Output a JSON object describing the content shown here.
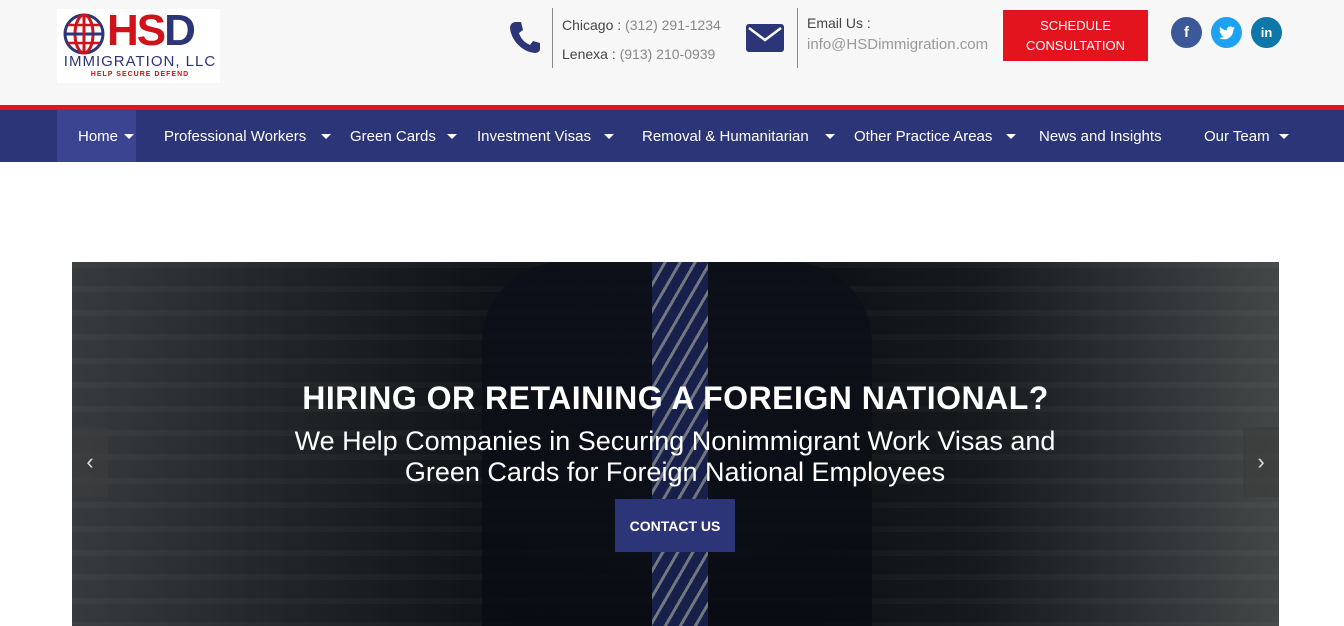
{
  "header": {
    "logo": {
      "mark": "HSD",
      "name": "IMMIGRATION, LLC",
      "tagline": "HELP SECURE DEFEND"
    },
    "phones": [
      {
        "label": "Chicago : ",
        "number": "(312) 291-1234"
      },
      {
        "label": "Lenexa : ",
        "number": "(913) 210-0939"
      }
    ],
    "email": {
      "label": "Email Us :",
      "value": "info@HSDimmigration.com"
    },
    "cta": {
      "line1": "SCHEDULE",
      "line2": "CONSULTATION"
    },
    "social": [
      {
        "icon": "facebook-icon",
        "glyph": "f"
      },
      {
        "icon": "twitter-icon",
        "glyph": "t"
      },
      {
        "icon": "linkedin-icon",
        "glyph": "in"
      }
    ]
  },
  "nav": {
    "items": [
      {
        "label": "Home",
        "dropdown": true,
        "active": true
      },
      {
        "label": "Professional Workers",
        "dropdown": true
      },
      {
        "label": "Green Cards",
        "dropdown": true
      },
      {
        "label": "Investment Visas",
        "dropdown": true
      },
      {
        "label": "Removal & Humanitarian",
        "dropdown": true
      },
      {
        "label": "Other Practice Areas",
        "dropdown": true
      },
      {
        "label": "News and Insights",
        "dropdown": false
      },
      {
        "label": "Our Team",
        "dropdown": true
      }
    ]
  },
  "hero": {
    "title": "HIRING OR RETAINING A FOREIGN NATIONAL?",
    "subtitle": "We Help Companies in Securing Nonimmigrant Work Visas and Green Cards for Foreign National Employees",
    "button": "CONTACT US",
    "prev": "‹",
    "next": "›"
  },
  "colors": {
    "brand_red": "#e3141d",
    "brand_navy": "#2b3577",
    "header_bg": "#f7f7f7"
  }
}
